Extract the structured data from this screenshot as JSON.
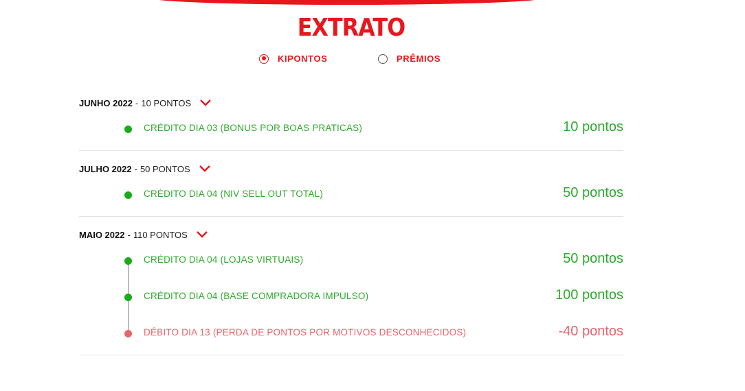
{
  "page": {
    "title": "EXTRATO"
  },
  "colors": {
    "brand_red": "#e8171d",
    "credit_green": "#2eaa2e",
    "debit_red": "#e8646a"
  },
  "filter": {
    "options": [
      {
        "label": "KIPONTOS",
        "selected": true
      },
      {
        "label": "PRÊMIOS",
        "selected": false
      }
    ]
  },
  "months": [
    {
      "name": "JUNHO 2022",
      "separator": "-",
      "total": "10 PONTOS",
      "entries": [
        {
          "type": "credit",
          "description": "CRÉDITO DIA 03 (BONUS POR BOAS PRATICAS)",
          "points": "10 pontos"
        }
      ]
    },
    {
      "name": "JULHO 2022",
      "separator": "-",
      "total": "50 PONTOS",
      "entries": [
        {
          "type": "credit",
          "description": "CRÉDITO DIA 04 (NIV SELL OUT TOTAL)",
          "points": "50 pontos"
        }
      ]
    },
    {
      "name": "MAIO 2022",
      "separator": "-",
      "total": "110 PONTOS",
      "entries": [
        {
          "type": "credit",
          "description": "CRÉDITO DIA 04 (LOJAS VIRTUAIS)",
          "points": "50 pontos"
        },
        {
          "type": "credit",
          "description": "CRÉDITO DIA 04 (BASE COMPRADORA IMPULSO)",
          "points": "100 pontos"
        },
        {
          "type": "debit",
          "description": "DÉBITO DIA 13 (PERDA DE PONTOS POR MOTIVOS DESCONHECIDOS)",
          "points": "-40 pontos"
        }
      ]
    }
  ]
}
